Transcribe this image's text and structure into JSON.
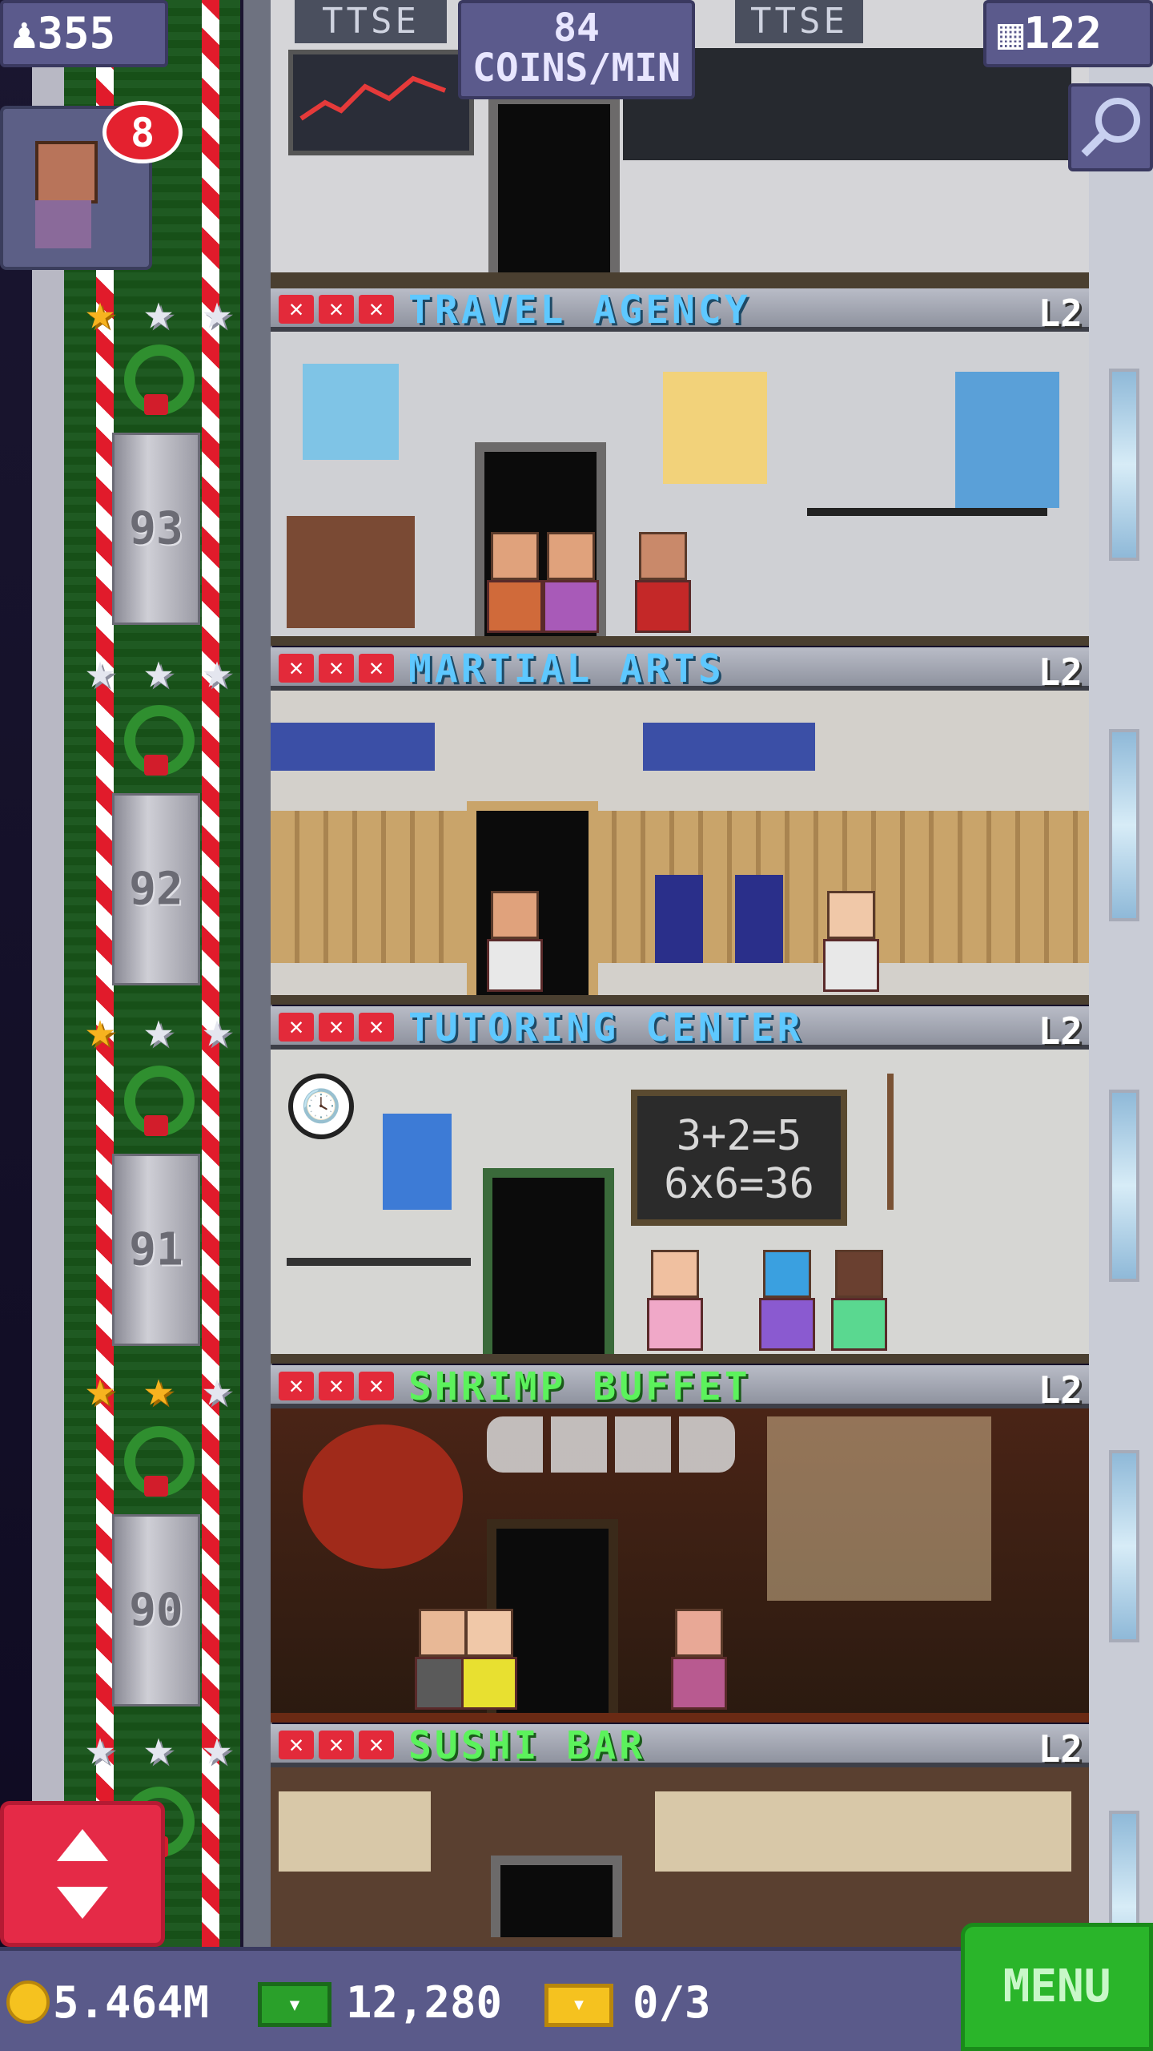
{
  "hud": {
    "population": "355",
    "coins_per_min_value": "84",
    "coins_per_min_label": "COINS/MIN",
    "floor_count": "122",
    "notification_count": "8"
  },
  "top_floor": {
    "signs": [
      "TTSE",
      "TTSE"
    ]
  },
  "elevator": {
    "floor_numbers": [
      "93",
      "92",
      "91",
      "90"
    ]
  },
  "floors": [
    {
      "name": "TRAVEL AGENCY",
      "level": "L2",
      "name_color": "#5ec8ff",
      "stars": [
        "gold",
        "silver",
        "silver"
      ]
    },
    {
      "name": "MARTIAL ARTS",
      "level": "L2",
      "name_color": "#5ec8ff",
      "stars": [
        "silver",
        "silver",
        "silver"
      ]
    },
    {
      "name": "TUTORING CENTER",
      "level": "L2",
      "name_color": "#5ec8ff",
      "stars": [
        "gold",
        "silver",
        "silver"
      ],
      "chalkboard": [
        "3+2=5",
        "6x6=36"
      ]
    },
    {
      "name": "SHRIMP BUFFET",
      "level": "L2",
      "name_color": "#5cf25c",
      "stars": [
        "gold",
        "gold",
        "silver"
      ]
    },
    {
      "name": "SUSHI BAR",
      "level": "L2",
      "name_color": "#5cf25c",
      "stars": [
        "silver",
        "silver",
        "silver"
      ]
    }
  ],
  "bottom_bar": {
    "coins": "5.464M",
    "bux": "12,280",
    "tickets": "0/3",
    "menu_label": "MENU"
  },
  "colors": {
    "service_name": "#5ec8ff",
    "food_name": "#5cf25c",
    "accent_red": "#e52a47",
    "menu_green": "#2ab52a"
  },
  "icons": [
    "person-icon",
    "building-icon",
    "search-icon",
    "up-down-arrows-icon",
    "coin-icon",
    "bux-icon",
    "ticket-icon",
    "star-icon",
    "wreath-icon"
  ]
}
